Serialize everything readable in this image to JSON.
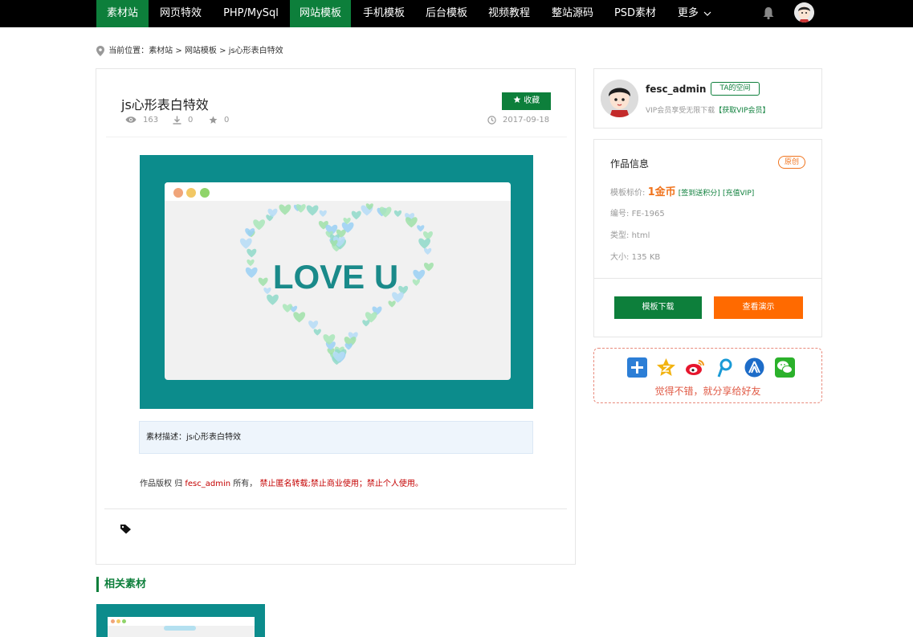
{
  "nav": {
    "items": [
      {
        "label": "素材站",
        "active": true
      },
      {
        "label": "网页特效",
        "active": false
      },
      {
        "label": "PHP/MySql",
        "active": false
      },
      {
        "label": "网站模板",
        "active": true
      },
      {
        "label": "手机模板",
        "active": false
      },
      {
        "label": "后台模板",
        "active": false
      },
      {
        "label": "视频教程",
        "active": false
      },
      {
        "label": "整站源码",
        "active": false
      },
      {
        "label": "PSD素材",
        "active": false
      },
      {
        "label": "更多",
        "active": false
      }
    ],
    "more_chevron": "chevron-down-icon"
  },
  "breadcrumb": {
    "prefix": "当前位置：",
    "items": [
      "素材站",
      "网站模板",
      "js心形表白特效"
    ],
    "sep": " > "
  },
  "item": {
    "title": "js心形表白特效",
    "fav_label": "收藏",
    "views": "163",
    "downloads": "0",
    "favorites": "0",
    "date": "2017-09-18",
    "preview_text": "LOVE U",
    "desc_label": "素材描述：",
    "desc_value": "js心形表白特效",
    "copyright_prefix": "作品版权 归 ",
    "copyright_owner": "fesc_admin",
    "copyright_mid": " 所有，",
    "copyright_warn": "禁止匿名转载;禁止商业使用；禁止个人使用。"
  },
  "related": {
    "title": "相关素材"
  },
  "author": {
    "name": "fesc_admin",
    "space_btn": "TA的空间",
    "vip_text": "VIP会员享受无限下载",
    "vip_link": "【获取VIP会员】"
  },
  "info": {
    "title": "作品信息",
    "badge": "原创",
    "price_label": "模板标价: ",
    "price_value": "1金币",
    "sign_link": "[签到送积分]",
    "vip_link": "[充值VIP]",
    "id_label": "编号: ",
    "id_value": "FE-1965",
    "type_label": "类型: ",
    "type_value": "html",
    "size_label": "大小: ",
    "size_value": "135 KB",
    "download_btn": "模板下载",
    "demo_btn": "查看演示"
  },
  "share": {
    "text": "觉得不错，就分享给好友",
    "icons": [
      "plus-share-icon",
      "qzone-icon",
      "weibo-icon",
      "tencent-weibo-icon",
      "renren-icon",
      "wechat-icon"
    ]
  },
  "colors": {
    "brand_green": "#0d7f3b",
    "orange": "#ff6a00",
    "teal": "#0c8c8c"
  }
}
